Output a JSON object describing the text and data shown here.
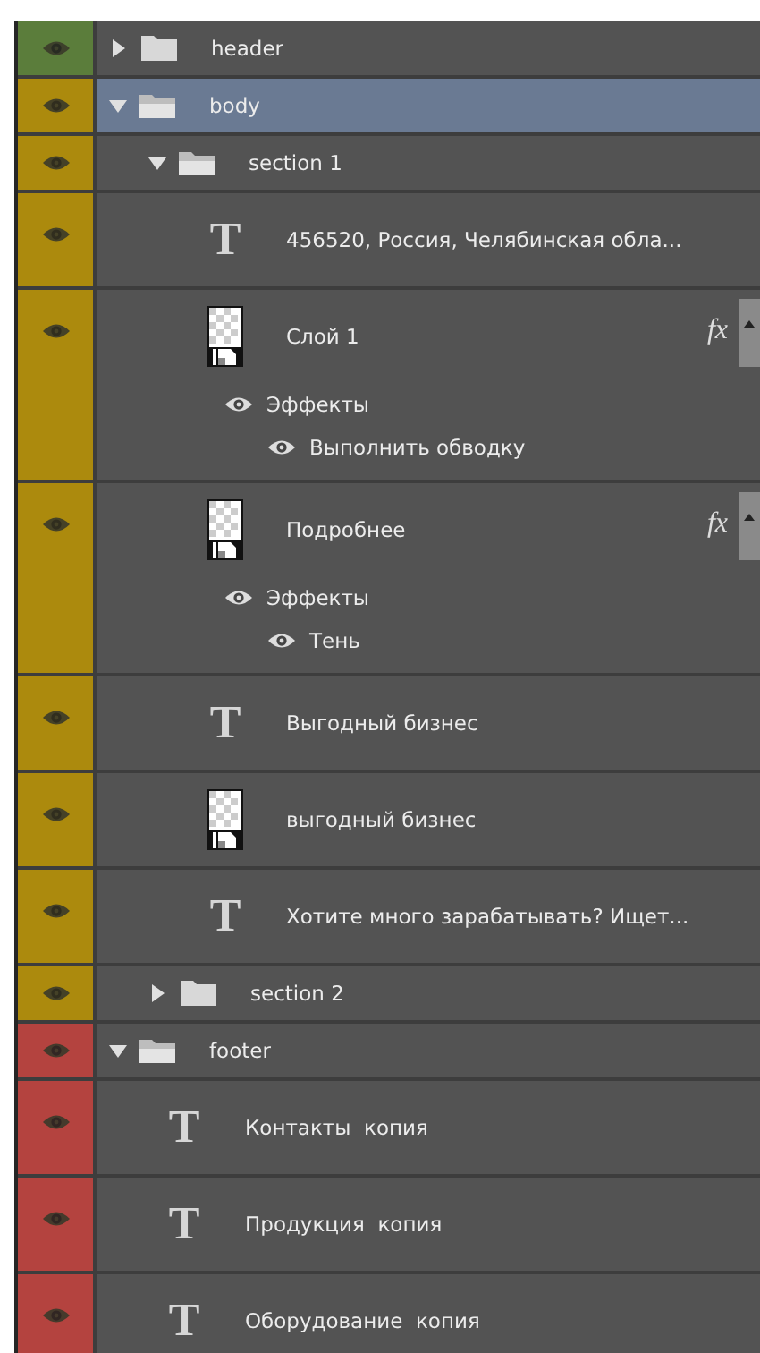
{
  "layers": [
    {
      "kind": "group",
      "name": "header",
      "color": "#5b7d3b",
      "selected": false,
      "expanded": false
    },
    {
      "kind": "group",
      "name": "body",
      "color": "#ac8a0d",
      "selected": true,
      "expanded": true,
      "children": [
        {
          "kind": "group",
          "name": "section 1",
          "selected": false,
          "expanded": true,
          "children": [
            {
              "kind": "text",
              "icon": "T",
              "name": "456520, Россия, Челябинская обла...",
              "selected": false
            },
            {
              "kind": "smart",
              "name": "Слой 1",
              "selected": false,
              "fx": "fx",
              "effects": {
                "label": "Эффекты",
                "items": [
                  "Выполнить обводку"
                ]
              }
            },
            {
              "kind": "smart",
              "name": "Подробнее",
              "selected": false,
              "fx": "fx",
              "effects": {
                "label": "Эффекты",
                "items": [
                  "Тень"
                ]
              }
            },
            {
              "kind": "text",
              "icon": "T",
              "name": "Выгодный бизнес",
              "selected": false
            },
            {
              "kind": "smart",
              "name": "выгодный бизнес",
              "selected": false
            },
            {
              "kind": "text",
              "icon": "T",
              "name": "Хотите много зарабатывать? Ищет...",
              "selected": false
            }
          ]
        },
        {
          "kind": "group",
          "name": "section 2",
          "selected": false,
          "expanded": false
        }
      ]
    },
    {
      "kind": "group",
      "name": "footer",
      "color": "#b4433f",
      "selected": false,
      "expanded": true,
      "children": [
        {
          "kind": "text",
          "icon": "T",
          "name": "Контакты  копия",
          "selected": false
        },
        {
          "kind": "text",
          "icon": "T",
          "name": "Продукция  копия",
          "selected": false
        },
        {
          "kind": "text",
          "icon": "T",
          "name": "Оборудование  копия",
          "selected": false
        }
      ]
    }
  ]
}
